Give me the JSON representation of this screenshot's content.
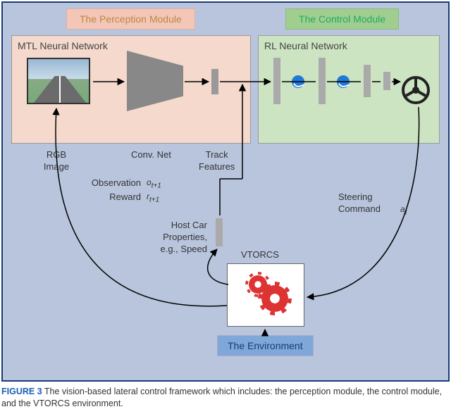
{
  "modules": {
    "perception_label": "The Perception Module",
    "control_label": "The Control Module",
    "perception_title": "MTL Neural Network",
    "control_title": "RL Neural Network"
  },
  "labels": {
    "rgb_image": "RGB\nImage",
    "conv_net": "Conv. Net",
    "track_features": "Track\nFeatures",
    "observation": "Observation",
    "obs_sym": "o",
    "obs_sub": "t+1",
    "reward": "Reward",
    "rew_sym": "r",
    "rew_sub": "t+1",
    "steering": "Steering\nCommand",
    "act_sym": "a",
    "act_sub": "t",
    "host_car": "Host Car\nProperties,\ne.g., Speed",
    "vtorcs": "VTORCS",
    "environment": "The Environment"
  },
  "caption": {
    "fig_num": "FIGURE 3",
    "text": " The vision-based lateral control framework which includes: the perception module, the control module, and the VTORCS environment."
  },
  "icons": {
    "road": "road-scene",
    "cnn": "trapezoid",
    "gear": "gear-icon",
    "wheel": "steering-wheel-icon"
  }
}
